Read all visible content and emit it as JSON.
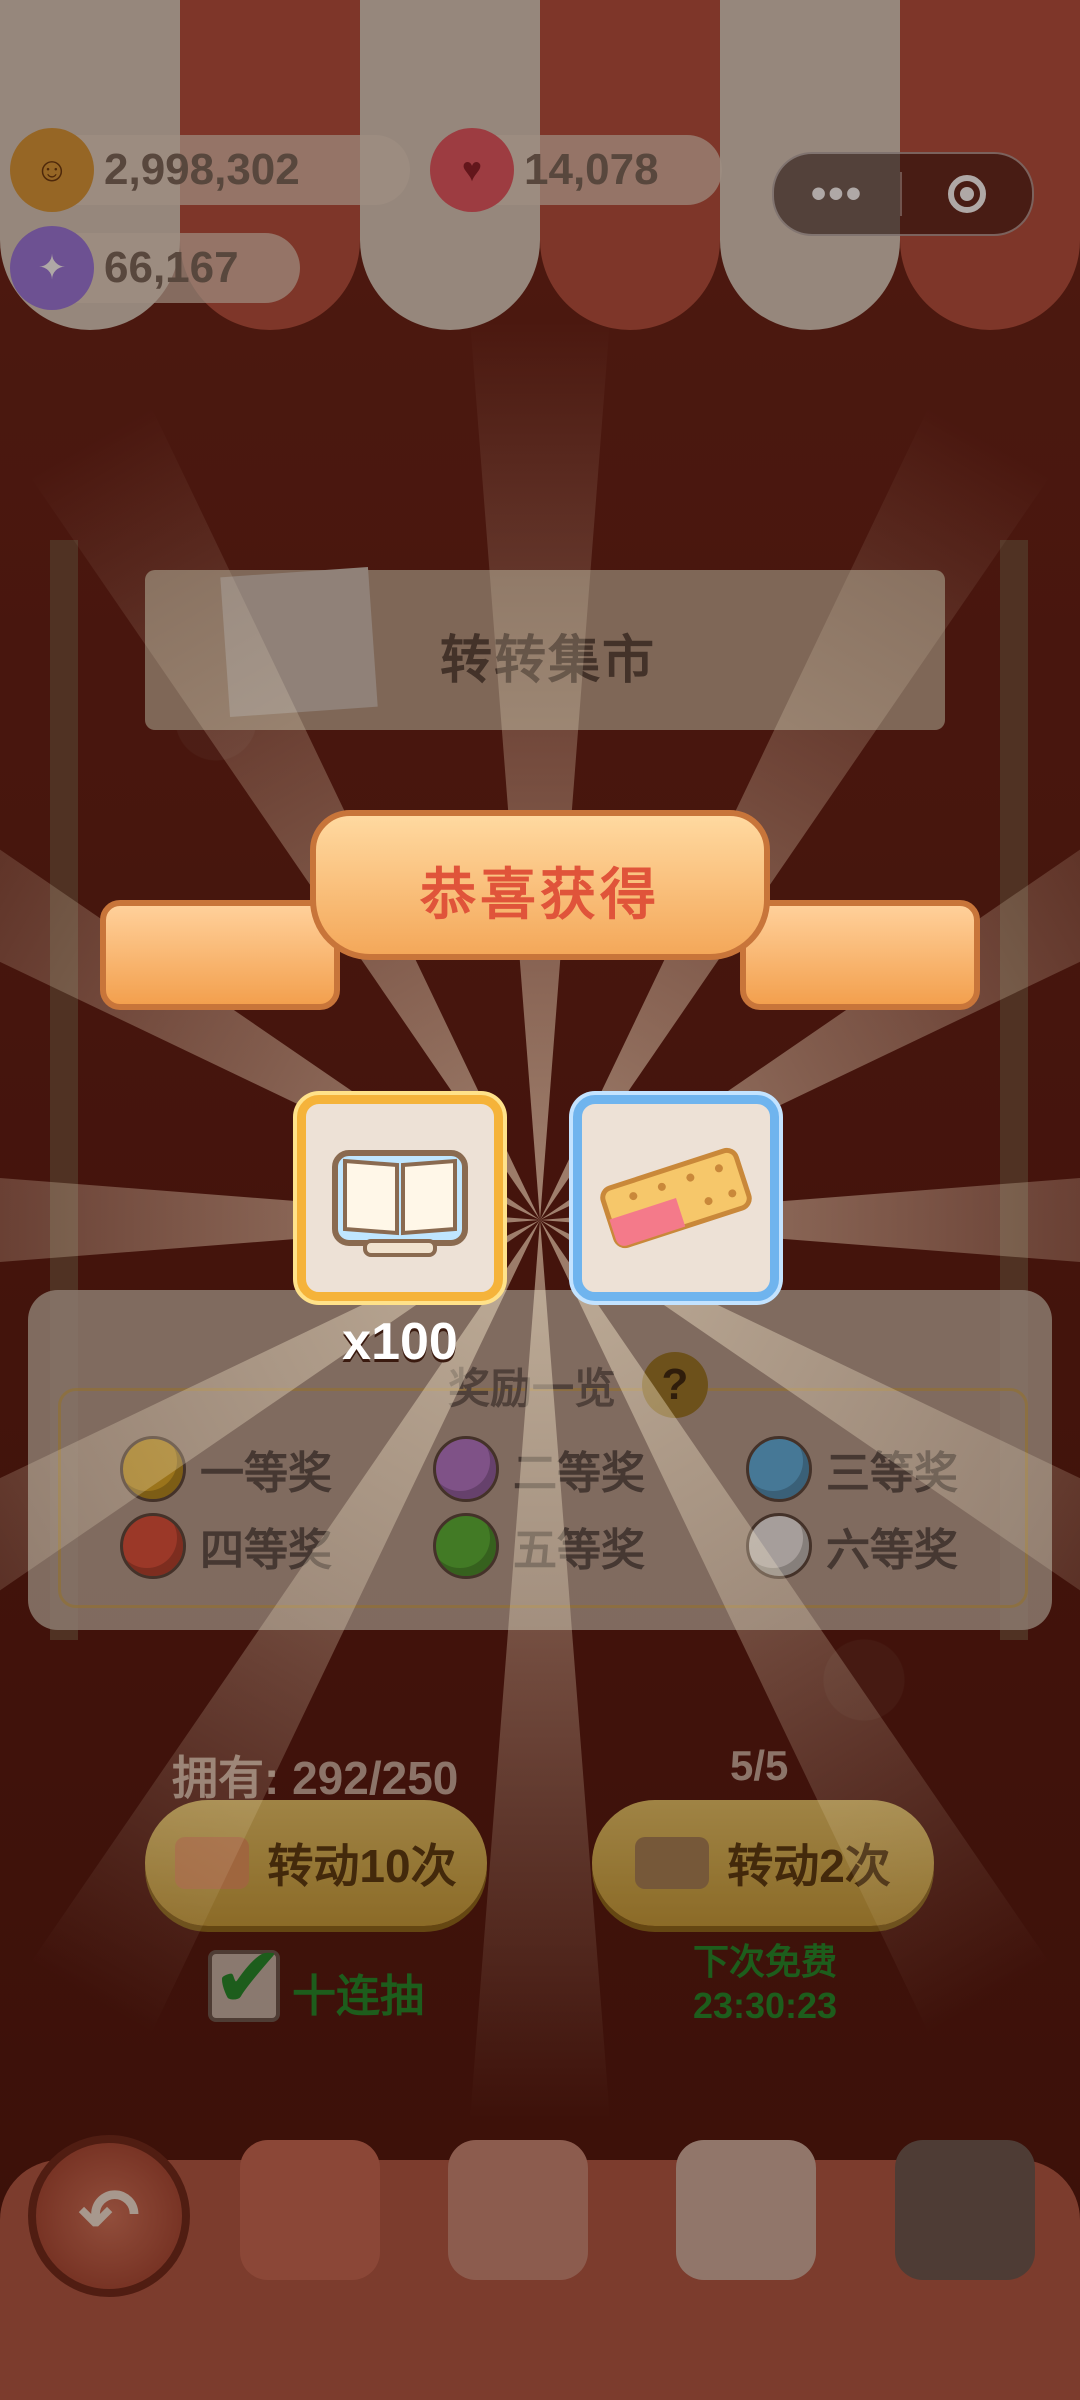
{
  "resources": {
    "coins": "2,998,302",
    "jelly": "14,078",
    "candy": "66,167"
  },
  "capsule": {
    "more": "•••"
  },
  "stall": {
    "title": "转转集市"
  },
  "popup": {
    "title": "恭喜获得",
    "rewards": [
      {
        "name": "book-reward",
        "qty": "x100"
      },
      {
        "name": "biscuit-reward",
        "qty": ""
      }
    ]
  },
  "prizes": {
    "title": "奖励一览",
    "help": "?",
    "items": [
      {
        "label": "一等奖",
        "color": "#e0b02a"
      },
      {
        "label": "二等奖",
        "color": "#b57bd0"
      },
      {
        "label": "三等奖",
        "color": "#5fb6e6"
      },
      {
        "label": "四等奖",
        "color": "#e0533e"
      },
      {
        "label": "五等奖",
        "color": "#58b83a"
      },
      {
        "label": "六等奖",
        "color": "#f2f0ee"
      }
    ]
  },
  "spin": {
    "owned": "拥有: 292/250",
    "ad_count": "5/5",
    "spin10_label": "转动10次",
    "spin2_label": "转动2次",
    "ten_pull_label": "十连抽",
    "free_label": "下次免费",
    "free_timer": "23:30:23",
    "ten_pull_checked": true
  },
  "colors": {
    "accent_green": "#1f8d2c",
    "button_gold": "#e7c76a",
    "ribbon_text": "#e0543a"
  }
}
